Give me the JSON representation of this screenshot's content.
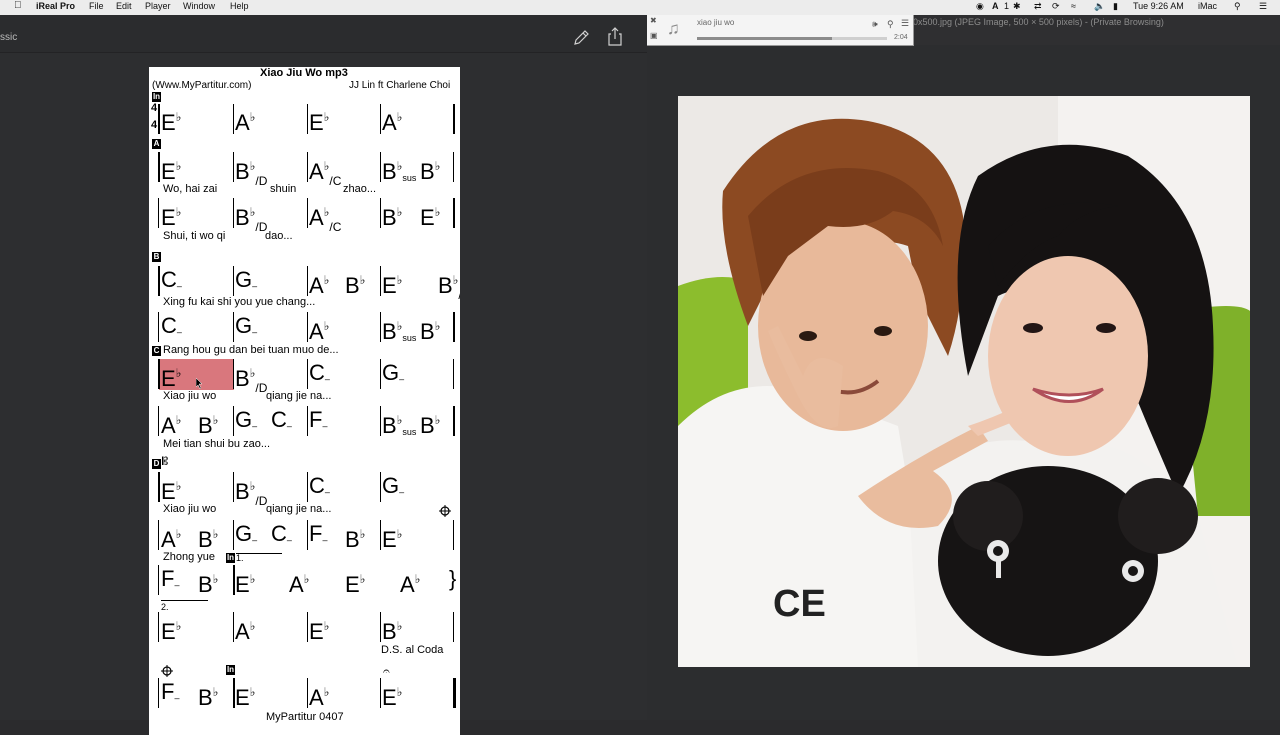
{
  "menubar": {
    "app": "iReal Pro",
    "menus": [
      "File",
      "Edit",
      "Player",
      "Window",
      "Help"
    ],
    "clock": "Tue 9:26 AM",
    "computer_name": "iMac",
    "badge": "1"
  },
  "left_window": {
    "side_label": "ssic"
  },
  "sheet": {
    "title": "Xiao Jiu Wo mp3",
    "source": "(Www.MyPartitur.com)",
    "artist": "JJ Lin ft Charlene Choi",
    "time_sig_top": "4",
    "time_sig_bottom": "4",
    "sections": {
      "in": "In",
      "a": "A",
      "b": "B",
      "c": "C",
      "d": "D"
    },
    "lyrics": {
      "r2a": "Wo, hai zai",
      "r2b": "shuin",
      "r2c": "zhao...",
      "r3a": "Shui, ti wo qi",
      "r3b": "dao...",
      "r4": "Xing fu kai shi you yue chang...",
      "r5": "Rang hou gu dan bei tuan muo de...",
      "r6a": "Xiao jiu wo",
      "r6b": "qiang jie na...",
      "r7": "Mei tian shui bu zao...",
      "r8a": "Xiao jiu wo",
      "r8b": "qiang jie na...",
      "r9": "Zhong yue"
    },
    "ending_1": "1.",
    "ending_2": "2.",
    "ds": "D.S. al Coda",
    "footer": "MyPartitur 0407"
  },
  "player": {
    "track": "xiao jiu wo",
    "time": "2:04",
    "progress": 0.71
  },
  "preview": {
    "title": "0x500.jpg (JPEG Image, 500 × 500 pixels) - (Private Browsing)"
  },
  "colors": {
    "highlight": "#d9777d",
    "dark_bg": "#2c2d2f"
  }
}
